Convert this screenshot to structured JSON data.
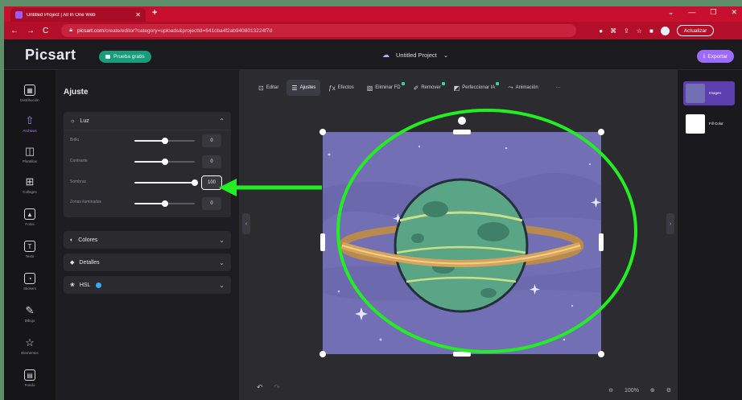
{
  "browser": {
    "tab_title": "Untitled Project | All In One Web",
    "new_tab": "+",
    "url_host": "picsart.com",
    "url_rest": "/create/editor?category=uploads&projectId=641cba4f2ab9408013224f7d",
    "update_label": "Actualizar",
    "nav_back": "←",
    "nav_forward": "→",
    "nav_reload": "C"
  },
  "header": {
    "logo": "Picsart",
    "trial_label": "Prueba gratis",
    "project_name": "Untitled Project",
    "export_label": "Exportar"
  },
  "leftbar": {
    "items": [
      {
        "label": "Distribución",
        "icon": "layout-icon"
      },
      {
        "label": "Archivos",
        "icon": "upload-icon"
      },
      {
        "label": "Plantillas",
        "icon": "templates-icon"
      },
      {
        "label": "Collages",
        "icon": "collage-icon"
      },
      {
        "label": "Fotos",
        "icon": "photos-icon"
      },
      {
        "label": "Texto",
        "icon": "text-icon"
      },
      {
        "label": "Stickers",
        "icon": "sticker-icon"
      },
      {
        "label": "Dibujo",
        "icon": "brush-icon"
      },
      {
        "label": "Elementos",
        "icon": "star-icon"
      },
      {
        "label": "Fondo",
        "icon": "background-icon"
      }
    ]
  },
  "panel": {
    "title": "Ajuste",
    "luz": {
      "label": "Luz",
      "rows": [
        {
          "label": "Brillo",
          "value": "0",
          "level": 0.5
        },
        {
          "label": "Contraste",
          "value": "0",
          "level": 0.5
        },
        {
          "label": "Sombras",
          "value": "100",
          "level": 1.0
        },
        {
          "label": "Zonas iluminadas",
          "value": "0",
          "level": 0.5
        }
      ]
    },
    "colores": "Colores",
    "detalles": "Detalles",
    "hsl": "HSL"
  },
  "toolbar": {
    "items": [
      {
        "label": "Editar",
        "active": false,
        "new": false
      },
      {
        "label": "Ajustes",
        "active": true,
        "new": false
      },
      {
        "label": "Efectos",
        "active": false,
        "new": false
      },
      {
        "label": "Eliminar FD",
        "active": false,
        "new": true
      },
      {
        "label": "Remover",
        "active": false,
        "new": true
      },
      {
        "label": "Perfeccionar IA",
        "active": false,
        "new": true
      },
      {
        "label": "Animación",
        "active": false,
        "new": false
      }
    ],
    "more": "···"
  },
  "canvas": {
    "zoom": "100%"
  },
  "layers": [
    {
      "name": "Imagen"
    },
    {
      "name": "Fill Color"
    }
  ],
  "colors": {
    "accent": "#9b6bff",
    "annotation": "#22ee22",
    "browser_red": "#c8102e"
  }
}
